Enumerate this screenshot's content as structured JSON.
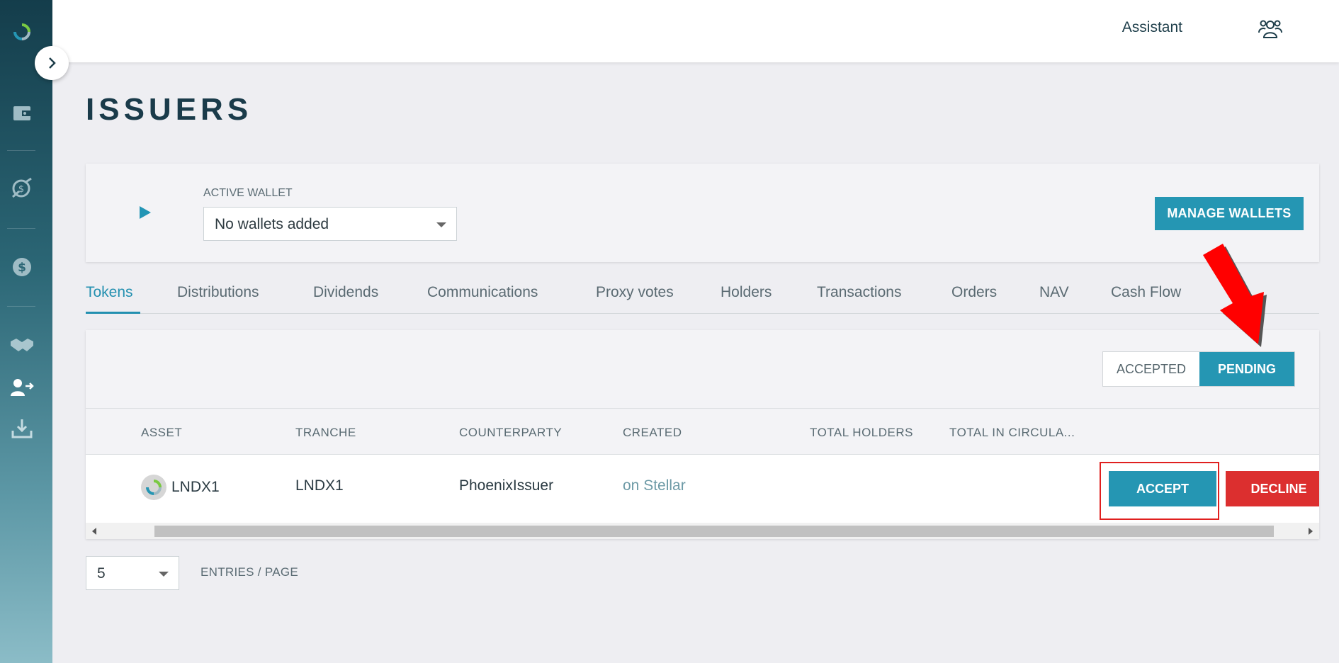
{
  "header": {
    "assistant_label": "Assistant"
  },
  "page": {
    "title": "ISSUERS"
  },
  "wallet": {
    "label": "ACTIVE WALLET",
    "selected": "No wallets added",
    "manage_label": "MANAGE WALLETS"
  },
  "tabs": [
    {
      "label": "Tokens",
      "active": true
    },
    {
      "label": "Distributions"
    },
    {
      "label": "Dividends"
    },
    {
      "label": "Communications"
    },
    {
      "label": "Proxy votes"
    },
    {
      "label": "Holders"
    },
    {
      "label": "Transactions"
    },
    {
      "label": "Orders"
    },
    {
      "label": "NAV"
    },
    {
      "label": "Cash Flow"
    }
  ],
  "filter": {
    "accepted_label": "ACCEPTED",
    "pending_label": "PENDING",
    "selected": "PENDING"
  },
  "table": {
    "columns": [
      "ASSET",
      "TRANCHE",
      "COUNTERPARTY",
      "CREATED",
      "TOTAL HOLDERS",
      "TOTAL IN CIRCULA..."
    ],
    "rows": [
      {
        "asset": "LNDX1",
        "tranche": "LNDX1",
        "counterparty": "PhoenixIssuer",
        "created": "on Stellar",
        "accept_label": "ACCEPT",
        "decline_label": "DECLINE"
      }
    ]
  },
  "pagination": {
    "per_page": "5",
    "label": "ENTRIES / PAGE"
  },
  "colors": {
    "accent": "#2596b3",
    "danger": "#dc2f2f",
    "highlight": "#e0201f"
  }
}
